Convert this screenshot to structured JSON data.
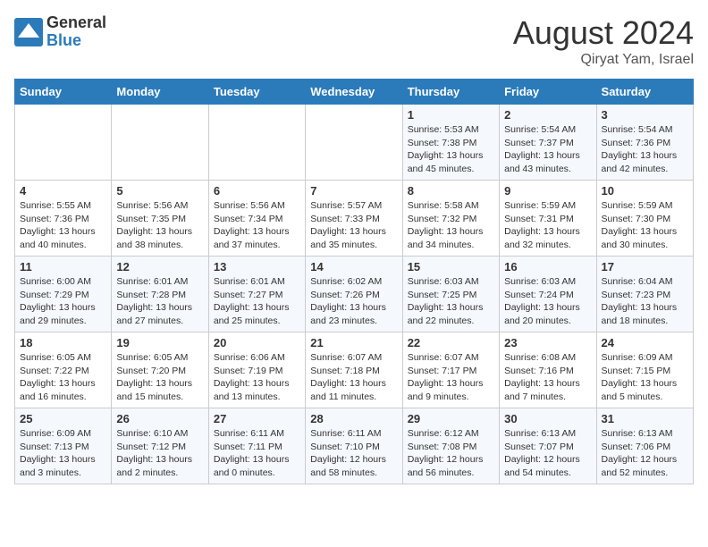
{
  "header": {
    "logo_general": "General",
    "logo_blue": "Blue",
    "month_year": "August 2024",
    "location": "Qiryat Yam, Israel"
  },
  "days_of_week": [
    "Sunday",
    "Monday",
    "Tuesday",
    "Wednesday",
    "Thursday",
    "Friday",
    "Saturday"
  ],
  "weeks": [
    [
      {
        "day": "",
        "info": ""
      },
      {
        "day": "",
        "info": ""
      },
      {
        "day": "",
        "info": ""
      },
      {
        "day": "",
        "info": ""
      },
      {
        "day": "1",
        "info": "Sunrise: 5:53 AM\nSunset: 7:38 PM\nDaylight: 13 hours\nand 45 minutes."
      },
      {
        "day": "2",
        "info": "Sunrise: 5:54 AM\nSunset: 7:37 PM\nDaylight: 13 hours\nand 43 minutes."
      },
      {
        "day": "3",
        "info": "Sunrise: 5:54 AM\nSunset: 7:36 PM\nDaylight: 13 hours\nand 42 minutes."
      }
    ],
    [
      {
        "day": "4",
        "info": "Sunrise: 5:55 AM\nSunset: 7:36 PM\nDaylight: 13 hours\nand 40 minutes."
      },
      {
        "day": "5",
        "info": "Sunrise: 5:56 AM\nSunset: 7:35 PM\nDaylight: 13 hours\nand 38 minutes."
      },
      {
        "day": "6",
        "info": "Sunrise: 5:56 AM\nSunset: 7:34 PM\nDaylight: 13 hours\nand 37 minutes."
      },
      {
        "day": "7",
        "info": "Sunrise: 5:57 AM\nSunset: 7:33 PM\nDaylight: 13 hours\nand 35 minutes."
      },
      {
        "day": "8",
        "info": "Sunrise: 5:58 AM\nSunset: 7:32 PM\nDaylight: 13 hours\nand 34 minutes."
      },
      {
        "day": "9",
        "info": "Sunrise: 5:59 AM\nSunset: 7:31 PM\nDaylight: 13 hours\nand 32 minutes."
      },
      {
        "day": "10",
        "info": "Sunrise: 5:59 AM\nSunset: 7:30 PM\nDaylight: 13 hours\nand 30 minutes."
      }
    ],
    [
      {
        "day": "11",
        "info": "Sunrise: 6:00 AM\nSunset: 7:29 PM\nDaylight: 13 hours\nand 29 minutes."
      },
      {
        "day": "12",
        "info": "Sunrise: 6:01 AM\nSunset: 7:28 PM\nDaylight: 13 hours\nand 27 minutes."
      },
      {
        "day": "13",
        "info": "Sunrise: 6:01 AM\nSunset: 7:27 PM\nDaylight: 13 hours\nand 25 minutes."
      },
      {
        "day": "14",
        "info": "Sunrise: 6:02 AM\nSunset: 7:26 PM\nDaylight: 13 hours\nand 23 minutes."
      },
      {
        "day": "15",
        "info": "Sunrise: 6:03 AM\nSunset: 7:25 PM\nDaylight: 13 hours\nand 22 minutes."
      },
      {
        "day": "16",
        "info": "Sunrise: 6:03 AM\nSunset: 7:24 PM\nDaylight: 13 hours\nand 20 minutes."
      },
      {
        "day": "17",
        "info": "Sunrise: 6:04 AM\nSunset: 7:23 PM\nDaylight: 13 hours\nand 18 minutes."
      }
    ],
    [
      {
        "day": "18",
        "info": "Sunrise: 6:05 AM\nSunset: 7:22 PM\nDaylight: 13 hours\nand 16 minutes."
      },
      {
        "day": "19",
        "info": "Sunrise: 6:05 AM\nSunset: 7:20 PM\nDaylight: 13 hours\nand 15 minutes."
      },
      {
        "day": "20",
        "info": "Sunrise: 6:06 AM\nSunset: 7:19 PM\nDaylight: 13 hours\nand 13 minutes."
      },
      {
        "day": "21",
        "info": "Sunrise: 6:07 AM\nSunset: 7:18 PM\nDaylight: 13 hours\nand 11 minutes."
      },
      {
        "day": "22",
        "info": "Sunrise: 6:07 AM\nSunset: 7:17 PM\nDaylight: 13 hours\nand 9 minutes."
      },
      {
        "day": "23",
        "info": "Sunrise: 6:08 AM\nSunset: 7:16 PM\nDaylight: 13 hours\nand 7 minutes."
      },
      {
        "day": "24",
        "info": "Sunrise: 6:09 AM\nSunset: 7:15 PM\nDaylight: 13 hours\nand 5 minutes."
      }
    ],
    [
      {
        "day": "25",
        "info": "Sunrise: 6:09 AM\nSunset: 7:13 PM\nDaylight: 13 hours\nand 3 minutes."
      },
      {
        "day": "26",
        "info": "Sunrise: 6:10 AM\nSunset: 7:12 PM\nDaylight: 13 hours\nand 2 minutes."
      },
      {
        "day": "27",
        "info": "Sunrise: 6:11 AM\nSunset: 7:11 PM\nDaylight: 13 hours\nand 0 minutes."
      },
      {
        "day": "28",
        "info": "Sunrise: 6:11 AM\nSunset: 7:10 PM\nDaylight: 12 hours\nand 58 minutes."
      },
      {
        "day": "29",
        "info": "Sunrise: 6:12 AM\nSunset: 7:08 PM\nDaylight: 12 hours\nand 56 minutes."
      },
      {
        "day": "30",
        "info": "Sunrise: 6:13 AM\nSunset: 7:07 PM\nDaylight: 12 hours\nand 54 minutes."
      },
      {
        "day": "31",
        "info": "Sunrise: 6:13 AM\nSunset: 7:06 PM\nDaylight: 12 hours\nand 52 minutes."
      }
    ]
  ]
}
